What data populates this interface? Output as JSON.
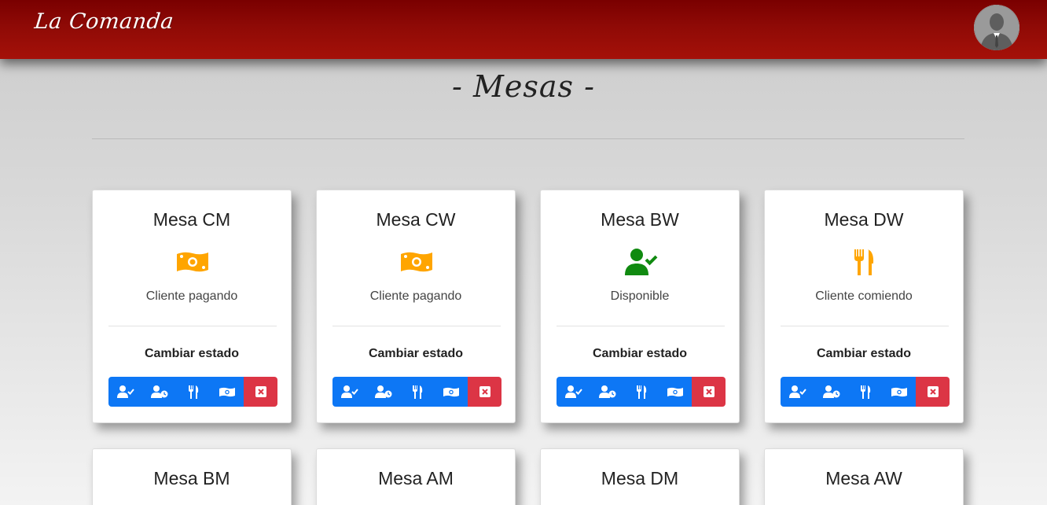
{
  "app": {
    "brand": "La Comanda"
  },
  "page": {
    "title": "- Mesas -"
  },
  "labels": {
    "change_state": "Cambiar estado"
  },
  "colors": {
    "header": "#8f0a06",
    "button_primary": "#0d77f5",
    "button_danger": "#dc3545",
    "status_paying": "#ffa500",
    "status_available": "#108a10",
    "status_eating": "#ffa500"
  },
  "action_buttons": [
    {
      "icon": "user-check-icon",
      "style": "primary"
    },
    {
      "icon": "user-clock-icon",
      "style": "primary"
    },
    {
      "icon": "utensils-icon",
      "style": "primary"
    },
    {
      "icon": "money-bill-icon",
      "style": "primary"
    },
    {
      "icon": "close-icon",
      "style": "danger"
    }
  ],
  "tables": [
    {
      "name": "Mesa CM",
      "status": "Cliente pagando",
      "icon": "money-bill-icon"
    },
    {
      "name": "Mesa CW",
      "status": "Cliente pagando",
      "icon": "money-bill-icon"
    },
    {
      "name": "Mesa BW",
      "status": "Disponible",
      "icon": "user-check-icon"
    },
    {
      "name": "Mesa DW",
      "status": "Cliente comiendo",
      "icon": "utensils-icon"
    },
    {
      "name": "Mesa BM"
    },
    {
      "name": "Mesa AM"
    },
    {
      "name": "Mesa DM"
    },
    {
      "name": "Mesa AW"
    }
  ]
}
